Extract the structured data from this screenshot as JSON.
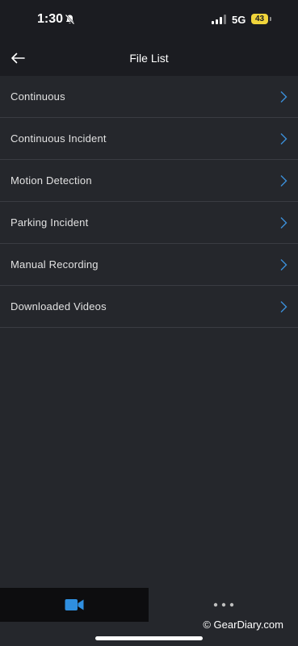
{
  "status_bar": {
    "time": "1:30",
    "network": "5G",
    "battery": "43",
    "icons": [
      "bell-slash-icon",
      "signal-icon",
      "battery-icon"
    ],
    "battery_color": "#f1d53b"
  },
  "nav": {
    "title": "File List",
    "back_icon": "arrow-left-icon"
  },
  "file_list": {
    "items": [
      {
        "label": "Continuous"
      },
      {
        "label": "Continuous Incident"
      },
      {
        "label": "Motion Detection"
      },
      {
        "label": "Parking Incident"
      },
      {
        "label": "Manual Recording"
      },
      {
        "label": "Downloaded Videos"
      }
    ],
    "chevron_icon": "chevron-right-icon",
    "chevron_color": "#3b8fd9"
  },
  "tab_bar": {
    "tabs": [
      {
        "icon": "video-camera-icon",
        "active": true,
        "color": "#2f8fe0"
      },
      {
        "icon": "more-dots-icon",
        "active": false,
        "color": "#bfbfbf"
      }
    ]
  },
  "watermark": "© GearDiary.com"
}
